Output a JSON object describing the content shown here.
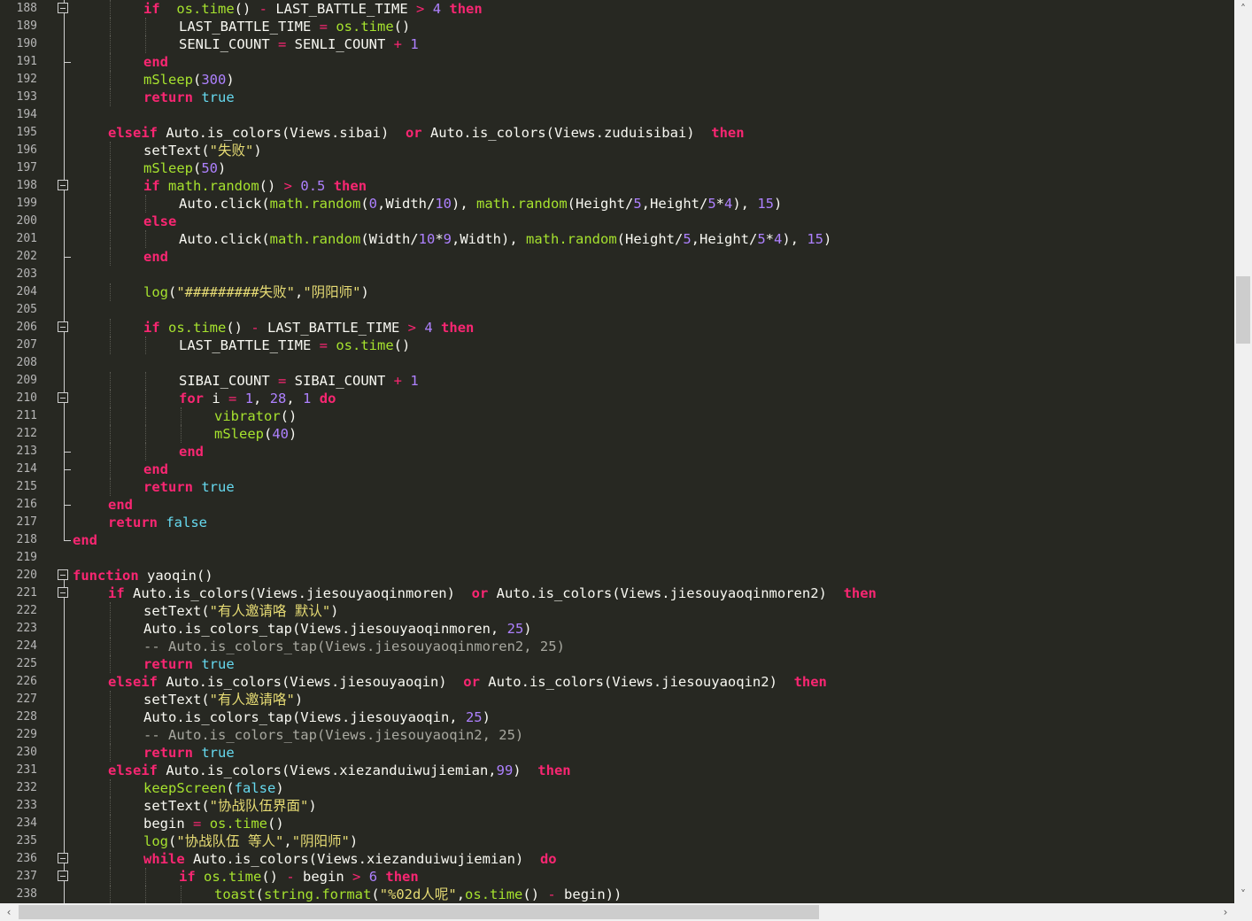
{
  "editor": {
    "lines": [
      {
        "n": "188",
        "fold": "box",
        "indent": 2,
        "code": [
          [
            "kw",
            "if"
          ],
          [
            "",
            "  "
          ],
          [
            "fn",
            "os.time"
          ],
          [
            "",
            "() "
          ],
          [
            "op",
            "-"
          ],
          [
            "",
            " LAST_BATTLE_TIME "
          ],
          [
            "op",
            ">"
          ],
          [
            "",
            " "
          ],
          [
            "num",
            "4"
          ],
          [
            "",
            " "
          ],
          [
            "kw",
            "then"
          ]
        ]
      },
      {
        "n": "189",
        "fold": "line",
        "indent": 3,
        "code": [
          [
            "",
            "LAST_BATTLE_TIME "
          ],
          [
            "op",
            "="
          ],
          [
            "",
            " "
          ],
          [
            "fn",
            "os.time"
          ],
          [
            "",
            "()"
          ]
        ]
      },
      {
        "n": "190",
        "fold": "line",
        "indent": 3,
        "code": [
          [
            "",
            "SENLI_COUNT "
          ],
          [
            "op",
            "="
          ],
          [
            "",
            " SENLI_COUNT "
          ],
          [
            "op",
            "+"
          ],
          [
            "",
            " "
          ],
          [
            "num",
            "1"
          ]
        ]
      },
      {
        "n": "191",
        "fold": "end",
        "indent": 2,
        "code": [
          [
            "kw",
            "end"
          ]
        ]
      },
      {
        "n": "192",
        "fold": "line",
        "indent": 2,
        "code": [
          [
            "fn",
            "mSleep"
          ],
          [
            "",
            "("
          ],
          [
            "num",
            "300"
          ],
          [
            "",
            ")"
          ]
        ]
      },
      {
        "n": "193",
        "fold": "line",
        "indent": 2,
        "code": [
          [
            "kw",
            "return"
          ],
          [
            "",
            " "
          ],
          [
            "bool",
            "true"
          ]
        ]
      },
      {
        "n": "194",
        "fold": "line",
        "indent": 0,
        "code": []
      },
      {
        "n": "195",
        "fold": "line",
        "indent": 1,
        "code": [
          [
            "kw",
            "elseif"
          ],
          [
            "",
            " Auto.is_colors(Views.sibai)  "
          ],
          [
            "kw",
            "or"
          ],
          [
            "",
            " Auto.is_colors(Views.zuduisibai)  "
          ],
          [
            "kw",
            "then"
          ]
        ]
      },
      {
        "n": "196",
        "fold": "line",
        "indent": 2,
        "code": [
          [
            "",
            "setText("
          ],
          [
            "str",
            "\"失败\""
          ],
          [
            "",
            ")"
          ]
        ]
      },
      {
        "n": "197",
        "fold": "line",
        "indent": 2,
        "code": [
          [
            "fn",
            "mSleep"
          ],
          [
            "",
            "("
          ],
          [
            "num",
            "50"
          ],
          [
            "",
            ")"
          ]
        ]
      },
      {
        "n": "198",
        "fold": "box",
        "indent": 2,
        "code": [
          [
            "kw",
            "if"
          ],
          [
            "",
            " "
          ],
          [
            "fn",
            "math.random"
          ],
          [
            "",
            "() "
          ],
          [
            "op",
            ">"
          ],
          [
            "",
            " "
          ],
          [
            "num",
            "0.5"
          ],
          [
            "",
            " "
          ],
          [
            "kw",
            "then"
          ]
        ]
      },
      {
        "n": "199",
        "fold": "line",
        "indent": 3,
        "code": [
          [
            "",
            "Auto.click("
          ],
          [
            "fn",
            "math.random"
          ],
          [
            "",
            "("
          ],
          [
            "num",
            "0"
          ],
          [
            "",
            ",Width/"
          ],
          [
            "num",
            "10"
          ],
          [
            "",
            "), "
          ],
          [
            "fn",
            "math.random"
          ],
          [
            "",
            "(Height/"
          ],
          [
            "num",
            "5"
          ],
          [
            "",
            ",Height/"
          ],
          [
            "num",
            "5"
          ],
          [
            "",
            "*"
          ],
          [
            "num",
            "4"
          ],
          [
            "",
            "), "
          ],
          [
            "num",
            "15"
          ],
          [
            "",
            ")"
          ]
        ]
      },
      {
        "n": "200",
        "fold": "line",
        "indent": 2,
        "code": [
          [
            "kw",
            "else"
          ]
        ]
      },
      {
        "n": "201",
        "fold": "line",
        "indent": 3,
        "code": [
          [
            "",
            "Auto.click("
          ],
          [
            "fn",
            "math.random"
          ],
          [
            "",
            "(Width/"
          ],
          [
            "num",
            "10"
          ],
          [
            "",
            "*"
          ],
          [
            "num",
            "9"
          ],
          [
            "",
            ",Width), "
          ],
          [
            "fn",
            "math.random"
          ],
          [
            "",
            "(Height/"
          ],
          [
            "num",
            "5"
          ],
          [
            "",
            ",Height/"
          ],
          [
            "num",
            "5"
          ],
          [
            "",
            "*"
          ],
          [
            "num",
            "4"
          ],
          [
            "",
            "), "
          ],
          [
            "num",
            "15"
          ],
          [
            "",
            ")"
          ]
        ]
      },
      {
        "n": "202",
        "fold": "end",
        "indent": 2,
        "code": [
          [
            "kw",
            "end"
          ]
        ]
      },
      {
        "n": "203",
        "fold": "line",
        "indent": 0,
        "code": []
      },
      {
        "n": "204",
        "fold": "line",
        "indent": 2,
        "code": [
          [
            "fn",
            "log"
          ],
          [
            "",
            "("
          ],
          [
            "str",
            "\"#########失败\""
          ],
          [
            "",
            ","
          ],
          [
            "str",
            "\"阴阳师\""
          ],
          [
            "",
            ")"
          ]
        ]
      },
      {
        "n": "205",
        "fold": "line",
        "indent": 0,
        "code": []
      },
      {
        "n": "206",
        "fold": "box",
        "indent": 2,
        "code": [
          [
            "kw",
            "if"
          ],
          [
            "",
            " "
          ],
          [
            "fn",
            "os.time"
          ],
          [
            "",
            "() "
          ],
          [
            "op",
            "-"
          ],
          [
            "",
            " LAST_BATTLE_TIME "
          ],
          [
            "op",
            ">"
          ],
          [
            "",
            " "
          ],
          [
            "num",
            "4"
          ],
          [
            "",
            " "
          ],
          [
            "kw",
            "then"
          ]
        ]
      },
      {
        "n": "207",
        "fold": "line",
        "indent": 3,
        "code": [
          [
            "",
            "LAST_BATTLE_TIME "
          ],
          [
            "op",
            "="
          ],
          [
            "",
            " "
          ],
          [
            "fn",
            "os.time"
          ],
          [
            "",
            "()"
          ]
        ]
      },
      {
        "n": "208",
        "fold": "line",
        "indent": 0,
        "code": []
      },
      {
        "n": "209",
        "fold": "line",
        "indent": 3,
        "code": [
          [
            "",
            "SIBAI_COUNT "
          ],
          [
            "op",
            "="
          ],
          [
            "",
            " SIBAI_COUNT "
          ],
          [
            "op",
            "+"
          ],
          [
            "",
            " "
          ],
          [
            "num",
            "1"
          ]
        ]
      },
      {
        "n": "210",
        "fold": "box",
        "indent": 3,
        "code": [
          [
            "kw",
            "for"
          ],
          [
            "",
            " i "
          ],
          [
            "op",
            "="
          ],
          [
            "",
            " "
          ],
          [
            "num",
            "1"
          ],
          [
            "",
            ", "
          ],
          [
            "num",
            "28"
          ],
          [
            "",
            ", "
          ],
          [
            "num",
            "1"
          ],
          [
            "",
            " "
          ],
          [
            "kw",
            "do"
          ]
        ]
      },
      {
        "n": "211",
        "fold": "line",
        "indent": 4,
        "code": [
          [
            "fn",
            "vibrator"
          ],
          [
            "",
            "()"
          ]
        ]
      },
      {
        "n": "212",
        "fold": "line",
        "indent": 4,
        "code": [
          [
            "fn",
            "mSleep"
          ],
          [
            "",
            "("
          ],
          [
            "num",
            "40"
          ],
          [
            "",
            ")"
          ]
        ]
      },
      {
        "n": "213",
        "fold": "end",
        "indent": 3,
        "code": [
          [
            "kw",
            "end"
          ]
        ]
      },
      {
        "n": "214",
        "fold": "end",
        "indent": 2,
        "code": [
          [
            "kw",
            "end"
          ]
        ]
      },
      {
        "n": "215",
        "fold": "line",
        "indent": 2,
        "code": [
          [
            "kw",
            "return"
          ],
          [
            "",
            " "
          ],
          [
            "bool",
            "true"
          ]
        ]
      },
      {
        "n": "216",
        "fold": "end",
        "indent": 1,
        "code": [
          [
            "kw",
            "end"
          ]
        ]
      },
      {
        "n": "217",
        "fold": "line",
        "indent": 1,
        "code": [
          [
            "kw",
            "return"
          ],
          [
            "",
            " "
          ],
          [
            "bool",
            "false"
          ]
        ]
      },
      {
        "n": "218",
        "fold": "last",
        "indent": 0,
        "code": [
          [
            "kw",
            "end"
          ]
        ]
      },
      {
        "n": "219",
        "fold": "none",
        "indent": 0,
        "code": []
      },
      {
        "n": "220",
        "fold": "boxtop",
        "indent": 0,
        "code": [
          [
            "kw",
            "function"
          ],
          [
            "",
            " yaoqin()"
          ]
        ]
      },
      {
        "n": "221",
        "fold": "box",
        "indent": 1,
        "code": [
          [
            "kw",
            "if"
          ],
          [
            "",
            " Auto.is_colors(Views.jiesouyaoqinmoren)  "
          ],
          [
            "kw",
            "or"
          ],
          [
            "",
            " Auto.is_colors(Views.jiesouyaoqinmoren2)  "
          ],
          [
            "kw",
            "then"
          ]
        ]
      },
      {
        "n": "222",
        "fold": "line",
        "indent": 2,
        "code": [
          [
            "",
            "setText("
          ],
          [
            "str",
            "\"有人邀请咯 默认\""
          ],
          [
            "",
            ")"
          ]
        ]
      },
      {
        "n": "223",
        "fold": "line",
        "indent": 2,
        "code": [
          [
            "",
            "Auto.is_colors_tap(Views.jiesouyaoqinmoren, "
          ],
          [
            "num",
            "25"
          ],
          [
            "",
            ")"
          ]
        ]
      },
      {
        "n": "224",
        "fold": "line",
        "indent": 2,
        "code": [
          [
            "cm",
            "-- Auto.is_colors_tap(Views.jiesouyaoqinmoren2, 25)"
          ]
        ]
      },
      {
        "n": "225",
        "fold": "line",
        "indent": 2,
        "code": [
          [
            "kw",
            "return"
          ],
          [
            "",
            " "
          ],
          [
            "bool",
            "true"
          ]
        ]
      },
      {
        "n": "226",
        "fold": "line",
        "indent": 1,
        "code": [
          [
            "kw",
            "elseif"
          ],
          [
            "",
            " Auto.is_colors(Views.jiesouyaoqin)  "
          ],
          [
            "kw",
            "or"
          ],
          [
            "",
            " Auto.is_colors(Views.jiesouyaoqin2)  "
          ],
          [
            "kw",
            "then"
          ]
        ]
      },
      {
        "n": "227",
        "fold": "line",
        "indent": 2,
        "code": [
          [
            "",
            "setText("
          ],
          [
            "str",
            "\"有人邀请咯\""
          ],
          [
            "",
            ")"
          ]
        ]
      },
      {
        "n": "228",
        "fold": "line",
        "indent": 2,
        "code": [
          [
            "",
            "Auto.is_colors_tap(Views.jiesouyaoqin, "
          ],
          [
            "num",
            "25"
          ],
          [
            "",
            ")"
          ]
        ]
      },
      {
        "n": "229",
        "fold": "line",
        "indent": 2,
        "code": [
          [
            "cm",
            "-- Auto.is_colors_tap(Views.jiesouyaoqin2, 25)"
          ]
        ]
      },
      {
        "n": "230",
        "fold": "line",
        "indent": 2,
        "code": [
          [
            "kw",
            "return"
          ],
          [
            "",
            " "
          ],
          [
            "bool",
            "true"
          ]
        ]
      },
      {
        "n": "231",
        "fold": "line",
        "indent": 1,
        "code": [
          [
            "kw",
            "elseif"
          ],
          [
            "",
            " Auto.is_colors(Views.xiezanduiwujiemian,"
          ],
          [
            "num",
            "99"
          ],
          [
            "",
            ")  "
          ],
          [
            "kw",
            "then"
          ]
        ]
      },
      {
        "n": "232",
        "fold": "line",
        "indent": 2,
        "code": [
          [
            "fn",
            "keepScreen"
          ],
          [
            "",
            "("
          ],
          [
            "bool",
            "false"
          ],
          [
            "",
            ")"
          ]
        ]
      },
      {
        "n": "233",
        "fold": "line",
        "indent": 2,
        "code": [
          [
            "",
            "setText("
          ],
          [
            "str",
            "\"协战队伍界面\""
          ],
          [
            "",
            ")"
          ]
        ]
      },
      {
        "n": "234",
        "fold": "line",
        "indent": 2,
        "code": [
          [
            "",
            "begin "
          ],
          [
            "op",
            "="
          ],
          [
            "",
            " "
          ],
          [
            "fn",
            "os.time"
          ],
          [
            "",
            "()"
          ]
        ]
      },
      {
        "n": "235",
        "fold": "line",
        "indent": 2,
        "code": [
          [
            "fn",
            "log"
          ],
          [
            "",
            "("
          ],
          [
            "str",
            "\"协战队伍 等人\""
          ],
          [
            "",
            ","
          ],
          [
            "str",
            "\"阴阳师\""
          ],
          [
            "",
            ")"
          ]
        ]
      },
      {
        "n": "236",
        "fold": "box",
        "indent": 2,
        "code": [
          [
            "kw",
            "while"
          ],
          [
            "",
            " Auto.is_colors(Views.xiezanduiwujiemian)  "
          ],
          [
            "kw",
            "do"
          ]
        ]
      },
      {
        "n": "237",
        "fold": "box",
        "indent": 3,
        "code": [
          [
            "kw",
            "if"
          ],
          [
            "",
            " "
          ],
          [
            "fn",
            "os.time"
          ],
          [
            "",
            "() "
          ],
          [
            "op",
            "-"
          ],
          [
            "",
            " begin "
          ],
          [
            "op",
            ">"
          ],
          [
            "",
            " "
          ],
          [
            "num",
            "6"
          ],
          [
            "",
            " "
          ],
          [
            "kw",
            "then"
          ]
        ]
      },
      {
        "n": "238",
        "fold": "line",
        "indent": 4,
        "code": [
          [
            "fn",
            "toast"
          ],
          [
            "",
            "("
          ],
          [
            "fn",
            "string.format"
          ],
          [
            "",
            "("
          ],
          [
            "str",
            "\"%02d人呢\""
          ],
          [
            "",
            ","
          ],
          [
            "fn",
            "os.time"
          ],
          [
            "",
            "() "
          ],
          [
            "op",
            "-"
          ],
          [
            "",
            " begin))"
          ]
        ]
      }
    ]
  },
  "scrollbars": {
    "up_arrow": "˄",
    "down_arrow": "˅",
    "left_arrow": "‹",
    "right_arrow": "›"
  }
}
